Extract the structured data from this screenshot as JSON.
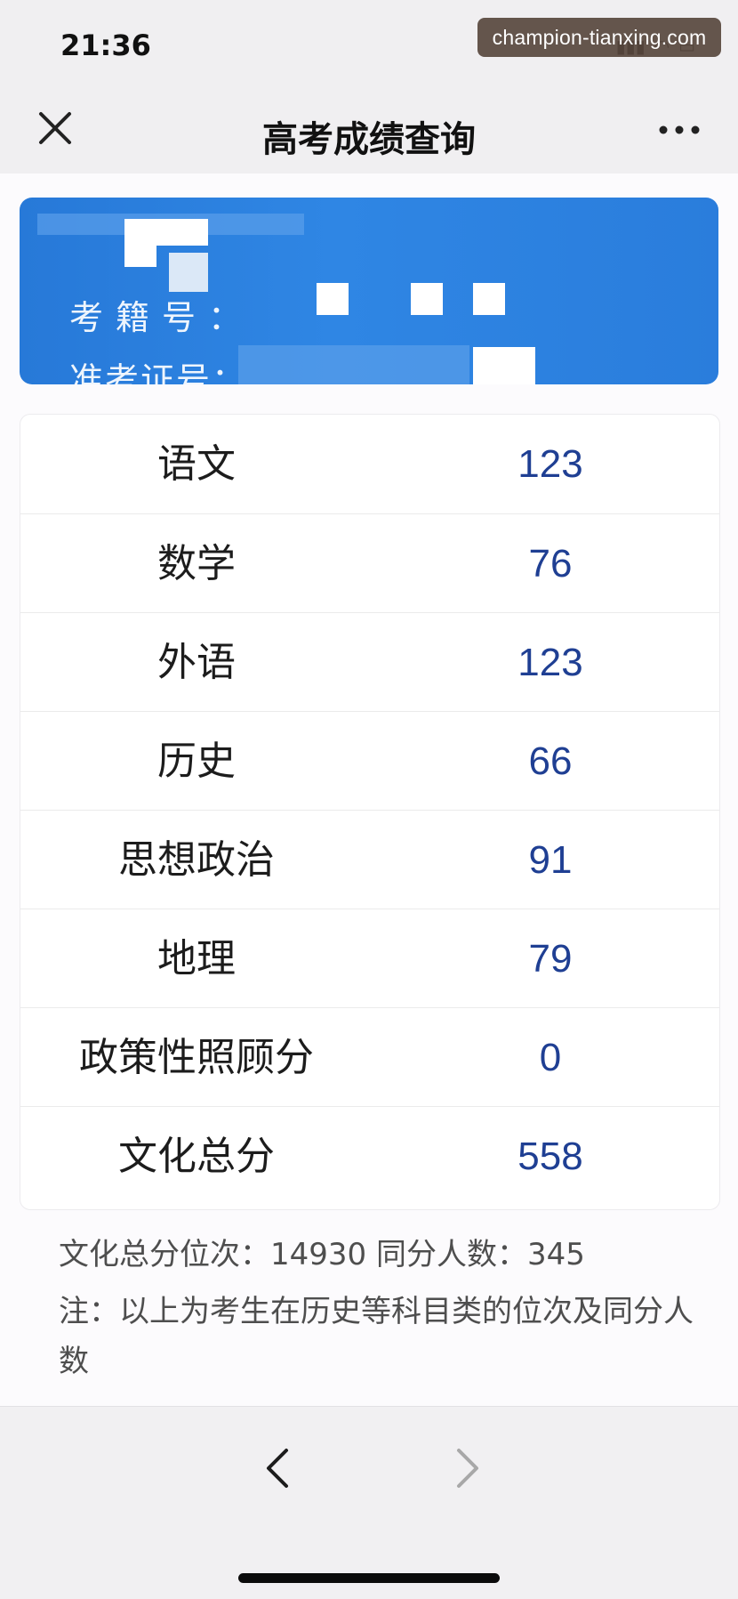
{
  "status_bar": {
    "time": "21:36"
  },
  "watermark": "champion-tianxing.com",
  "nav": {
    "title": "高考成绩查询",
    "close_icon": "close-icon",
    "more_icon": "more-dots-icon"
  },
  "identity_card": {
    "label_registration": "考籍号：",
    "label_ticket": "准考证号："
  },
  "scores": [
    {
      "subject": "语文",
      "score": "123"
    },
    {
      "subject": "数学",
      "score": "76"
    },
    {
      "subject": "外语",
      "score": "123"
    },
    {
      "subject": "历史",
      "score": "66"
    },
    {
      "subject": "思想政治",
      "score": "91"
    },
    {
      "subject": "地理",
      "score": "79"
    },
    {
      "subject": "政策性照顾分",
      "score": "0"
    },
    {
      "subject": "文化总分",
      "score": "558"
    }
  ],
  "rank_line": "文化总分位次：14930 同分人数：345",
  "note": "注：以上为考生在历史等科目类的位次及同分人数",
  "toolbar": {
    "back_icon": "chevron-left-icon",
    "forward_icon": "chevron-right-icon"
  },
  "colors": {
    "card_blue": "#2f86e4",
    "score_text": "#1f3f93"
  }
}
